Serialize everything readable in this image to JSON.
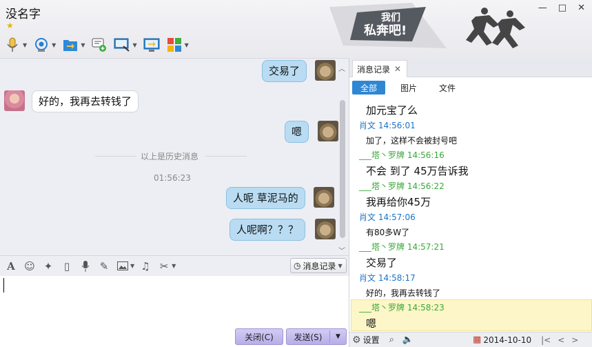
{
  "window": {
    "title": "没名字",
    "controls": [
      "—",
      "□",
      "✕"
    ]
  },
  "banner": {
    "text_line1": "我们",
    "text_line2": "私奔吧!"
  },
  "toolbar": [
    {
      "icon": "microphone-icon"
    },
    {
      "icon": "webcam-icon"
    },
    {
      "icon": "folder-transfer-icon"
    },
    {
      "icon": "message-add-icon"
    },
    {
      "icon": "screen-share-icon"
    },
    {
      "icon": "remote-desktop-icon"
    },
    {
      "icon": "apps-grid-icon"
    }
  ],
  "chat": {
    "messages": [
      {
        "side": "right",
        "text": "交易了"
      },
      {
        "side": "left",
        "text": "好的，我再去转钱了"
      },
      {
        "side": "right",
        "text": "嗯"
      },
      {
        "side": "right",
        "text": "人呢 草泥马的"
      },
      {
        "side": "right",
        "text": "人呢啊？？？"
      }
    ],
    "history_divider": "以上是历史消息",
    "timestamp": "01:56:23"
  },
  "input_toolbar": {
    "icons": [
      "font-icon",
      "emoji-icon",
      "magic-icon",
      "shake-icon",
      "voice-icon",
      "edit-icon",
      "image-icon",
      "music-icon",
      "scissors-icon"
    ],
    "history_button": "消息记录"
  },
  "actions": {
    "close_label": "关闭(C)",
    "send_label": "发送(S)"
  },
  "history_panel": {
    "tab_label": "消息记录",
    "filters": [
      "全部",
      "图片",
      "文件"
    ],
    "entries": [
      {
        "type": "text",
        "size": "big",
        "text": "加元宝了么"
      },
      {
        "type": "name",
        "color": "blue",
        "text": "肖文 14:56:01"
      },
      {
        "type": "text",
        "size": "small",
        "text": "加了，这样不会被封号吧"
      },
      {
        "type": "name",
        "color": "green",
        "text": "___塔丶罗牌 14:56:16"
      },
      {
        "type": "text",
        "size": "big",
        "text": "不会 到了 45万告诉我"
      },
      {
        "type": "name",
        "color": "green",
        "text": "___塔丶罗牌 14:56:22"
      },
      {
        "type": "text",
        "size": "big",
        "text": "我再给你45万"
      },
      {
        "type": "name",
        "color": "blue",
        "text": "肖文 14:57:06"
      },
      {
        "type": "text",
        "size": "small",
        "text": "有80多W了"
      },
      {
        "type": "name",
        "color": "green",
        "text": "___塔丶罗牌 14:57:21"
      },
      {
        "type": "text",
        "size": "big",
        "text": "交易了"
      },
      {
        "type": "name",
        "color": "blue",
        "text": "肖文 14:58:17"
      },
      {
        "type": "text",
        "size": "small",
        "text": "好的，我再去转钱了"
      },
      {
        "type": "name",
        "color": "green",
        "text": "___塔丶罗牌 14:58:23"
      },
      {
        "type": "text",
        "size": "big",
        "text": "嗯"
      }
    ],
    "footer": {
      "settings_label": "设置",
      "date": "2014-10-10"
    }
  }
}
